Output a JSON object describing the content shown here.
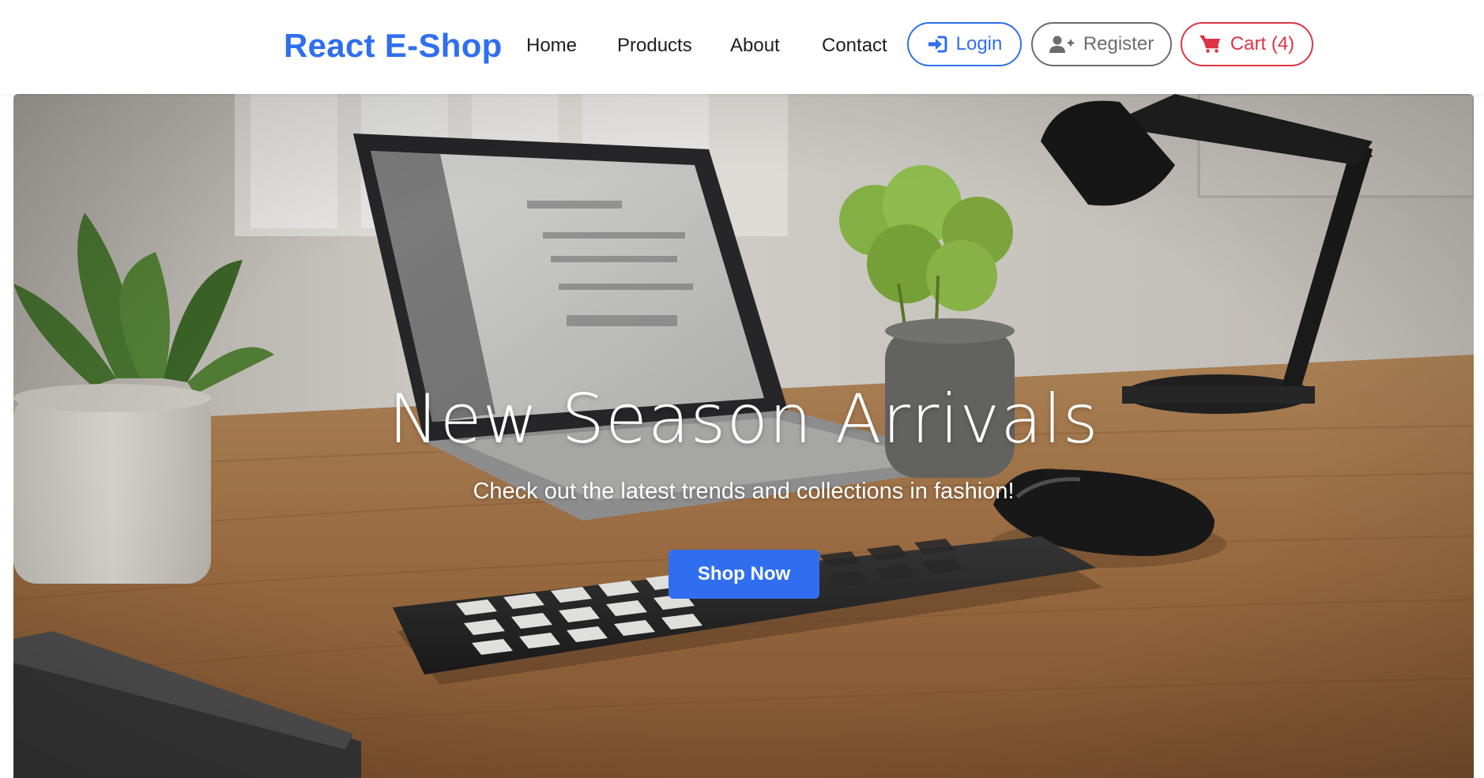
{
  "nav": {
    "brand": "React E-Shop",
    "links": [
      "Home",
      "Products",
      "About",
      "Contact"
    ],
    "login_label": "Login",
    "register_label": "Register",
    "cart_label": "Cart (4)",
    "icons": {
      "login": "sign-in-icon",
      "register": "user-plus-icon",
      "cart": "cart-icon"
    }
  },
  "hero": {
    "title": "New Season Arrivals",
    "subtitle": "Check out the latest trends and collections in fashion!",
    "cta_label": "Shop Now"
  },
  "colors": {
    "brand": "#2f6fef",
    "primary": "#2f6fef",
    "secondary": "#6c6c6c",
    "danger": "#dc3545",
    "nav_text": "#1e1e1e"
  }
}
